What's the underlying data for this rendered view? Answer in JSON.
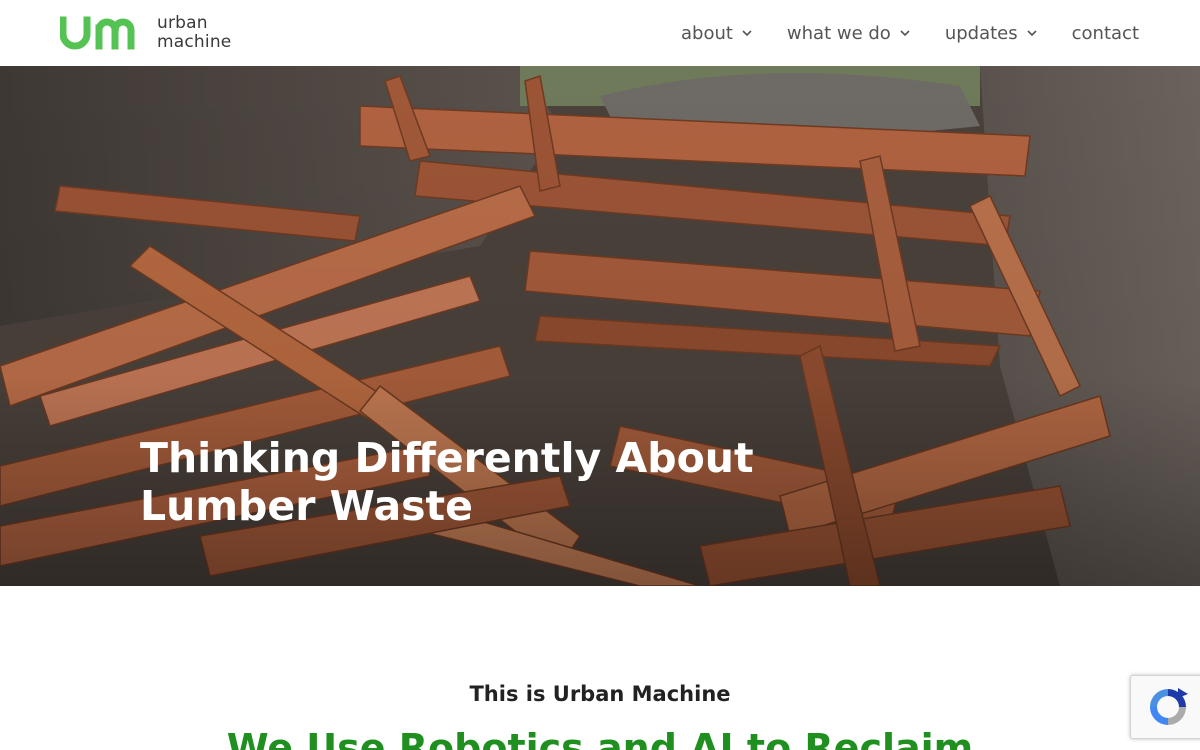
{
  "brand": {
    "mark": "um",
    "name_line1": "urban",
    "name_line2": "machine",
    "accent_color": "#55c254"
  },
  "nav": {
    "items": [
      {
        "label": "about",
        "has_dropdown": true
      },
      {
        "label": "what we do",
        "has_dropdown": true
      },
      {
        "label": "updates",
        "has_dropdown": true
      },
      {
        "label": "contact",
        "has_dropdown": false
      }
    ]
  },
  "hero": {
    "title_line1": "Thinking Differently About",
    "title_line2": "Lumber Waste",
    "image": "pile-of-reclaimed-lumber-in-dumpster"
  },
  "intro": {
    "eyebrow": "This is Urban Machine",
    "heading": "We Use Robotics and AI to Reclaim",
    "heading_color": "#1f8f1f"
  },
  "recaptcha": {
    "icon": "recaptcha-icon"
  }
}
